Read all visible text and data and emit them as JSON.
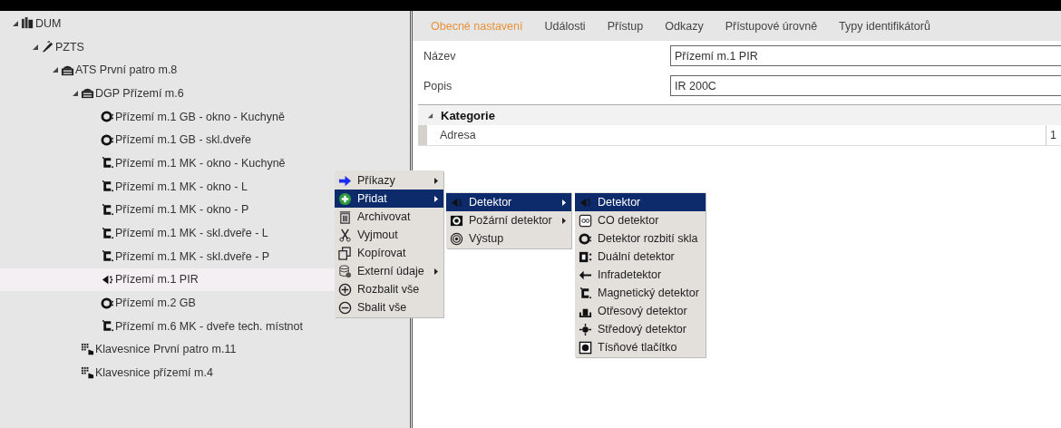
{
  "tree": [
    {
      "label": "DUM",
      "kind": "building",
      "expanded": true,
      "selected": false,
      "children": [
        {
          "label": "PZTS",
          "kind": "plug",
          "expanded": true,
          "selected": false,
          "children": [
            {
              "label": "ATS První patro m.8",
              "kind": "panel",
              "expanded": true,
              "selected": false,
              "children": [
                {
                  "label": "DGP Přízemí m.6",
                  "kind": "panel",
                  "expanded": true,
                  "selected": false,
                  "children": [
                    {
                      "label": "Přízemí m.1 GB - okno - Kuchyně",
                      "kind": "glass",
                      "selected": false
                    },
                    {
                      "label": "Přízemí m.1 GB - skl.dveře",
                      "kind": "glass",
                      "selected": false
                    },
                    {
                      "label": "Přízemí m.1 MK - okno - Kuchyně",
                      "kind": "magnet",
                      "selected": false
                    },
                    {
                      "label": "Přízemí m.1 MK - okno - L",
                      "kind": "magnet",
                      "selected": false
                    },
                    {
                      "label": "Přízemí m.1 MK - okno - P",
                      "kind": "magnet",
                      "selected": false
                    },
                    {
                      "label": "Přízemí m.1 MK - skl.dveře - L",
                      "kind": "magnet",
                      "selected": false
                    },
                    {
                      "label": "Přízemí m.1 MK - skl.dveře - P",
                      "kind": "magnet",
                      "selected": false
                    },
                    {
                      "label": "Přízemí m.1 PIR",
                      "kind": "pir",
                      "selected": true
                    },
                    {
                      "label": "Přízemí m.2 GB",
                      "kind": "glass",
                      "selected": false
                    },
                    {
                      "label": "Přízemí m.6 MK - dveře tech. místnot",
                      "kind": "magnet",
                      "selected": false
                    }
                  ]
                },
                {
                  "label": "Klavesnice První patro m.11",
                  "kind": "keypad",
                  "selected": false
                },
                {
                  "label": "Klavesnice přízemí m.4",
                  "kind": "keypad",
                  "selected": false
                }
              ]
            }
          ]
        }
      ]
    }
  ],
  "tabs": [
    {
      "label": "Obecné nastavení",
      "selected": true
    },
    {
      "label": "Události",
      "selected": false
    },
    {
      "label": "Přístup",
      "selected": false
    },
    {
      "label": "Odkazy",
      "selected": false
    },
    {
      "label": "Přístupové úrovně",
      "selected": false
    },
    {
      "label": "Typy identifikátorů",
      "selected": false
    }
  ],
  "fields": [
    {
      "label": "Název",
      "value": "Přízemí m.1 PIR"
    },
    {
      "label": "Popis",
      "value": "IR 200C"
    }
  ],
  "category": {
    "title": "Kategorie",
    "expanded": true,
    "properties": [
      {
        "label": "Adresa",
        "value": "1"
      }
    ]
  },
  "menus": [
    {
      "items": [
        {
          "label": "Příkazy",
          "kind": "arrow",
          "submenu": true,
          "selected": false
        },
        {
          "label": "Přidat",
          "kind": "plus",
          "submenu": true,
          "selected": true
        },
        {
          "label": "Archivovat",
          "kind": "trash",
          "submenu": false,
          "selected": false
        },
        {
          "label": "Vyjmout",
          "kind": "scissors",
          "submenu": false,
          "selected": false
        },
        {
          "label": "Kopírovat",
          "kind": "copy",
          "submenu": false,
          "selected": false
        },
        {
          "label": "Externí údaje",
          "kind": "database",
          "submenu": true,
          "selected": false
        },
        {
          "label": "Rozbalit vše",
          "kind": "expand",
          "submenu": false,
          "selected": false
        },
        {
          "label": "Sbalit vše",
          "kind": "collapse",
          "submenu": false,
          "selected": false
        }
      ]
    },
    {
      "items": [
        {
          "label": "Detektor",
          "kind": "pir",
          "submenu": true,
          "selected": true
        },
        {
          "label": "Požární detektor",
          "kind": "fire",
          "submenu": true,
          "selected": false
        },
        {
          "label": "Výstup",
          "kind": "output",
          "submenu": false,
          "selected": false
        }
      ]
    },
    {
      "items": [
        {
          "label": "Detektor",
          "kind": "pir",
          "submenu": false,
          "selected": true
        },
        {
          "label": "CO detektor",
          "kind": "co",
          "submenu": false,
          "selected": false
        },
        {
          "label": "Detektor rozbití skla",
          "kind": "glass",
          "submenu": false,
          "selected": false
        },
        {
          "label": "Duální detektor",
          "kind": "dual",
          "submenu": false,
          "selected": false
        },
        {
          "label": "Infradetektor",
          "kind": "infra",
          "submenu": false,
          "selected": false
        },
        {
          "label": "Magnetický detektor",
          "kind": "magnet",
          "submenu": false,
          "selected": false
        },
        {
          "label": "Otřesový detektor",
          "kind": "shock",
          "submenu": false,
          "selected": false
        },
        {
          "label": "Středový detektor",
          "kind": "center",
          "submenu": false,
          "selected": false
        },
        {
          "label": "Tísňové tlačítko",
          "kind": "panic",
          "submenu": false,
          "selected": false
        }
      ]
    }
  ]
}
